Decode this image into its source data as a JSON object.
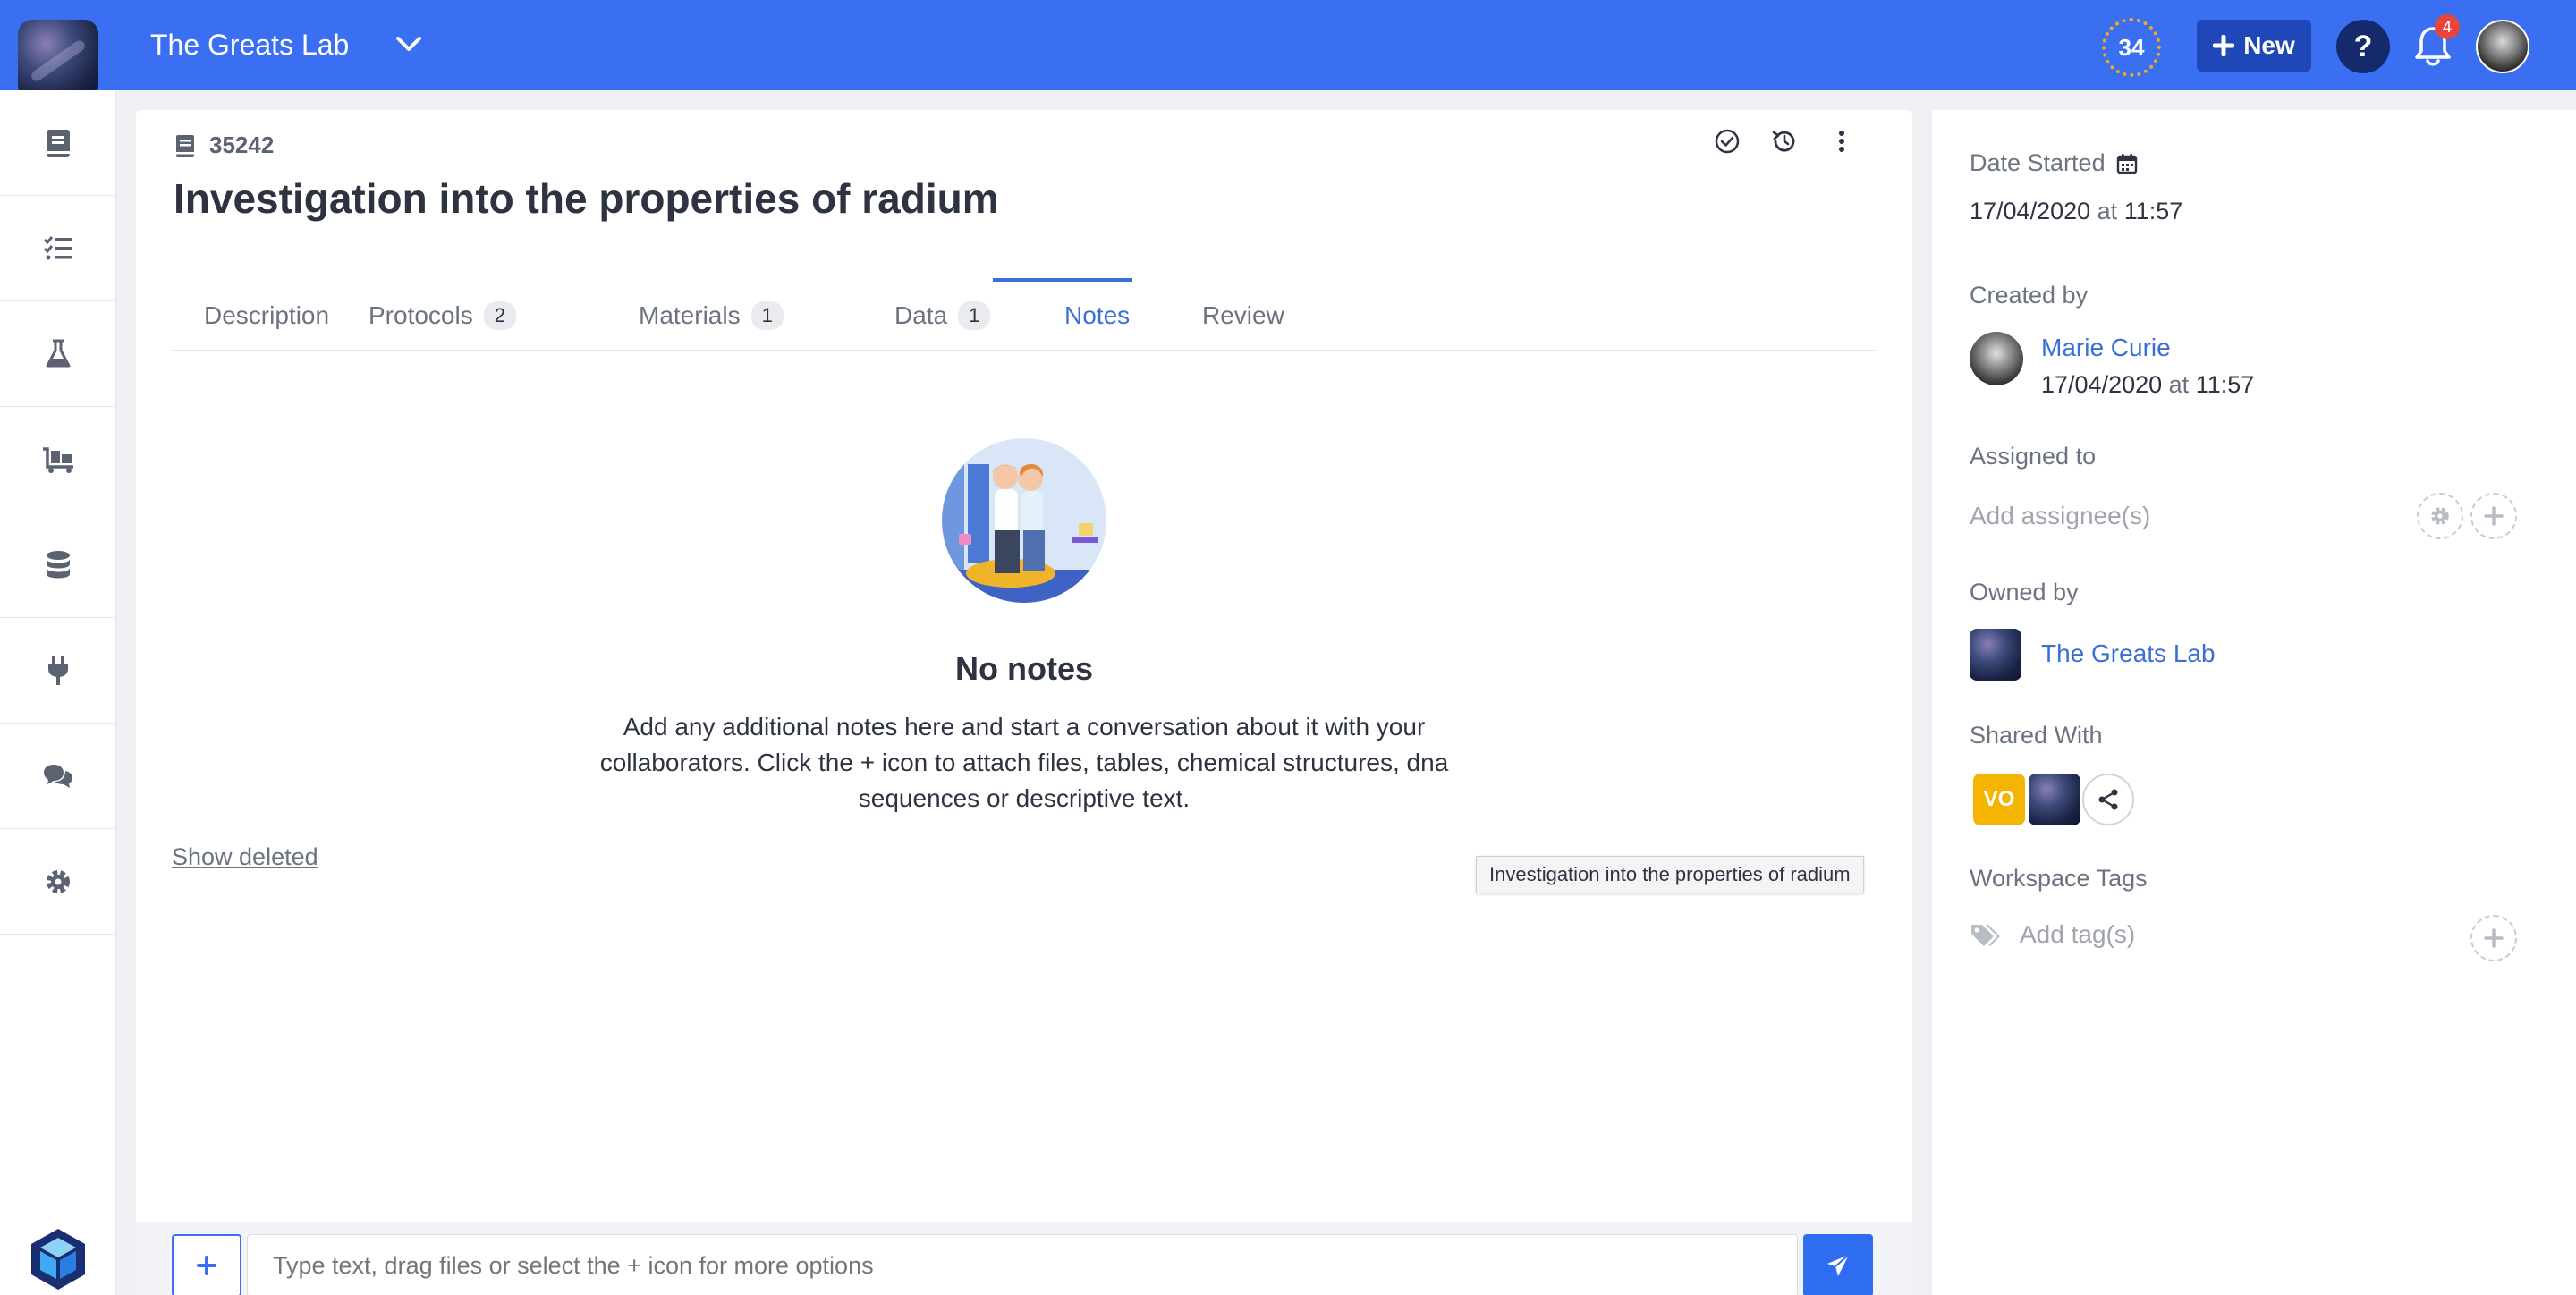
{
  "header": {
    "workspace_name": "The Greats Lab",
    "counter": "34",
    "new_label": "New",
    "help_label": "?",
    "notifications_count": "4",
    "brand_color": "#3a6ff2"
  },
  "sidebar": {
    "items": [
      {
        "icon": "notebook-icon"
      },
      {
        "icon": "checklist-icon"
      },
      {
        "icon": "flask-icon"
      },
      {
        "icon": "inventory-cart-icon"
      },
      {
        "icon": "database-icon"
      },
      {
        "icon": "plug-icon"
      },
      {
        "icon": "chat-icon"
      },
      {
        "icon": "gear-icon"
      }
    ]
  },
  "entry": {
    "id": "35242",
    "title": "Investigation into the properties of radium",
    "tabs": [
      {
        "label": "Description",
        "count": null
      },
      {
        "label": "Protocols",
        "count": "2"
      },
      {
        "label": "Materials",
        "count": "1"
      },
      {
        "label": "Data",
        "count": "1"
      },
      {
        "label": "Notes",
        "count": null,
        "active": true
      },
      {
        "label": "Review",
        "count": null
      }
    ],
    "empty_title": "No notes",
    "empty_description": "Add any additional notes here and start a conversation about it with your collaborators. Click the + icon to attach files, tables, chemical structures, dna sequences or descriptive text.",
    "show_deleted": "Show deleted",
    "tooltip": "Investigation into the properties of radium"
  },
  "composer": {
    "placeholder": "Type text, drag files or select the + icon for more options"
  },
  "details": {
    "date_started_label": "Date Started",
    "date_started_date": "17/04/2020",
    "at": "at",
    "date_started_time": "11:57",
    "created_by_label": "Created by",
    "creator_name": "Marie Curie",
    "created_date": "17/04/2020",
    "created_time": "11:57",
    "assigned_label": "Assigned to",
    "assignee_placeholder": "Add assignee(s)",
    "owned_label": "Owned by",
    "owner_name": "The Greats Lab",
    "shared_label": "Shared With",
    "shared_initials": "VO",
    "tags_label": "Workspace Tags",
    "tags_placeholder": "Add tag(s)"
  }
}
